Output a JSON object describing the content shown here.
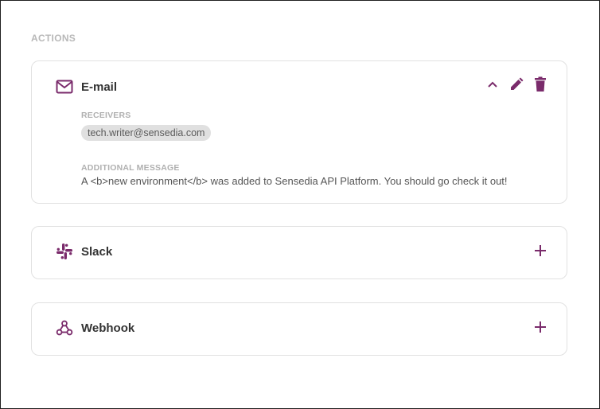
{
  "section": {
    "title": "ACTIONS"
  },
  "colors": {
    "accent": "#7a2b6b",
    "label": "#b0b0b0",
    "chip_bg": "#e0e0e0"
  },
  "email": {
    "title": "E-mail",
    "icon": "mail-icon",
    "receivers_label": "RECEIVERS",
    "receivers": [
      "tech.writer@sensedia.com"
    ],
    "message_label": "ADDITIONAL MESSAGE",
    "message": "A <b>new environment</b> was added to Sensedia API Platform. You should go check it out!",
    "actions": [
      "collapse-icon",
      "edit-icon",
      "delete-icon"
    ]
  },
  "slack": {
    "title": "Slack",
    "icon": "slack-icon"
  },
  "webhook": {
    "title": "Webhook",
    "icon": "webhook-icon"
  }
}
